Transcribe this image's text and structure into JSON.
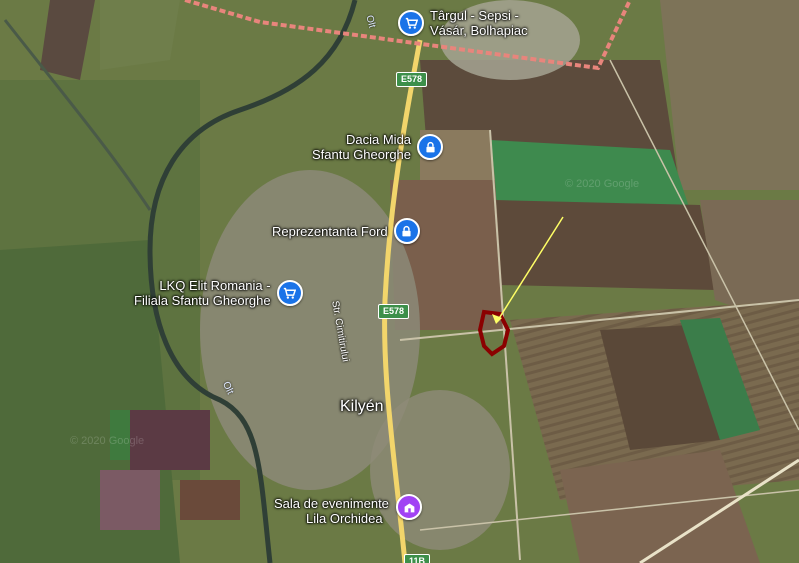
{
  "town": "Kilyén",
  "river": "Olt",
  "street": "Str. Cimitirului",
  "roads": {
    "main": "E578",
    "bottom": "11B"
  },
  "watermark": "© 2020 Google",
  "pois": [
    {
      "icon": "shopping-cart-icon",
      "color": "#1a73e8",
      "lines": [
        "Târgul - Sepsi -",
        "Vásár, Bolhapiac"
      ]
    },
    {
      "icon": "lock-icon",
      "color": "#1a73e8",
      "lines": [
        "Dacia Mida",
        "Sfantu Gheorghe"
      ]
    },
    {
      "icon": "lock-icon",
      "color": "#1a73e8",
      "lines": [
        "Reprezentanta Ford"
      ]
    },
    {
      "icon": "shopping-cart-icon",
      "color": "#1a73e8",
      "lines": [
        "LKQ Elit Romania -",
        "Filiala Sfantu Gheorghe"
      ]
    },
    {
      "icon": "building-icon",
      "color": "#a142f4",
      "lines": [
        "Sala de evenimente",
        "Lila Orchidea"
      ]
    }
  ],
  "colors": {
    "boundary": "#e8857c",
    "annotation_outline": "#8b0000",
    "arrow": "#ffff66",
    "road": "#f2d56b"
  }
}
